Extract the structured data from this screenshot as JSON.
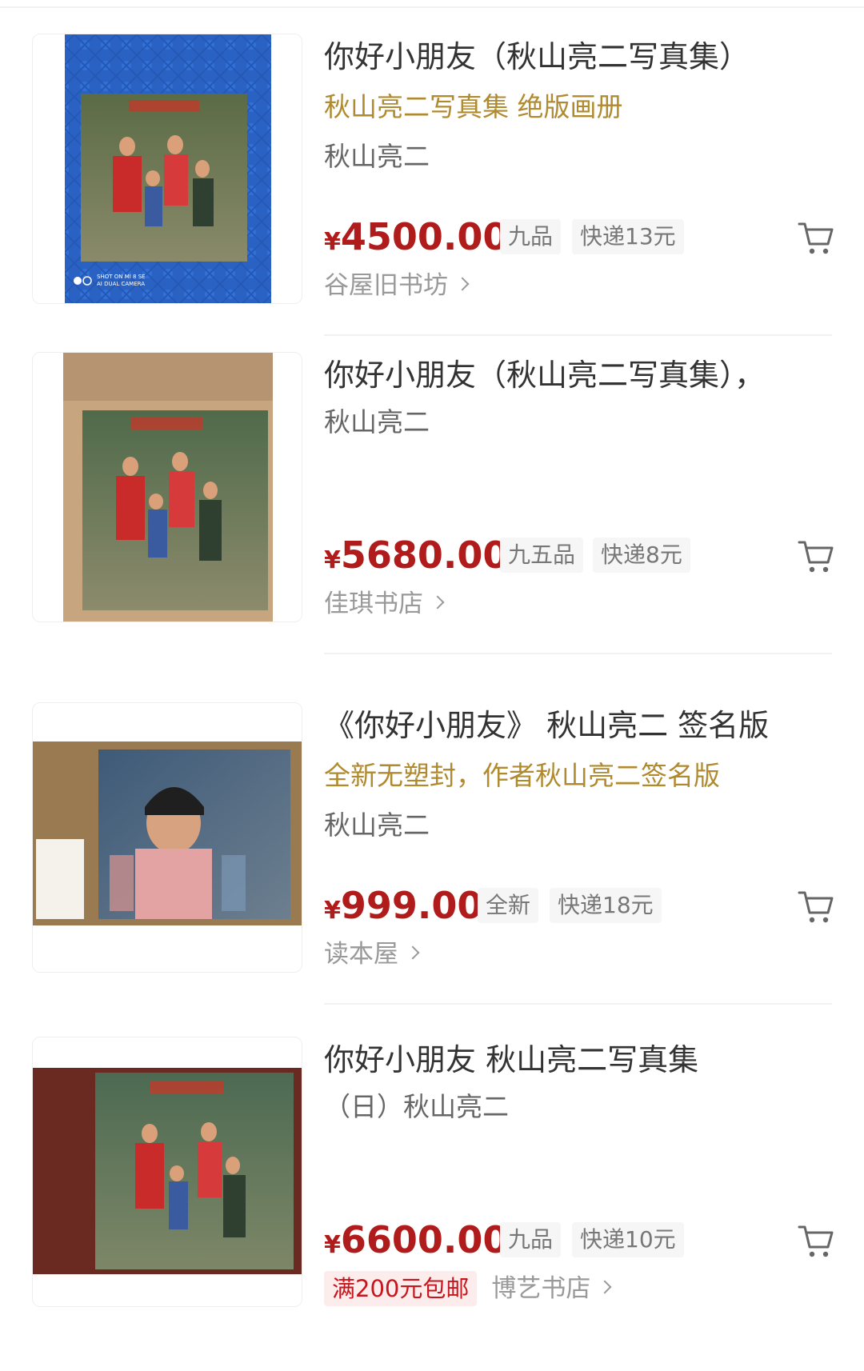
{
  "listings": [
    {
      "title": "你好小朋友（秋山亮二写真集）",
      "subtitle": "秋山亮二写真集 绝版画册",
      "author": "秋山亮二",
      "price_symbol": "¥",
      "price": "4500.00",
      "condition": "九品",
      "shipping": "快递13元",
      "shop": "谷屋旧书坊",
      "image_text": "SHOT ON MI 8 SE AI DUAL CAMERA"
    },
    {
      "title": "你好小朋友（秋山亮二写真集），",
      "author": "秋山亮二",
      "price_symbol": "¥",
      "price": "5680.00",
      "condition": "九五品",
      "shipping": "快递8元",
      "shop": "佳琪书店"
    },
    {
      "title": "《你好小朋友》 秋山亮二 签名版",
      "subtitle": "全新无塑封，作者秋山亮二签名版",
      "author": "秋山亮二",
      "price_symbol": "¥",
      "price": "999.00",
      "condition": "全新",
      "shipping": "快递18元",
      "shop": "读本屋"
    },
    {
      "title": "你好小朋友 秋山亮二写真集",
      "author": "（日）秋山亮二",
      "price_symbol": "¥",
      "price": "6600.00",
      "condition": "九品",
      "shipping": "快递10元",
      "promo": "满200元包邮",
      "shop": "博艺书店"
    }
  ],
  "icons": {
    "cart": "shopping-cart-icon",
    "chevron": "chevron-right-icon"
  },
  "colors": {
    "price": "#b01c1c",
    "subtitle": "#b08a2e",
    "promo": "#c4161c"
  }
}
